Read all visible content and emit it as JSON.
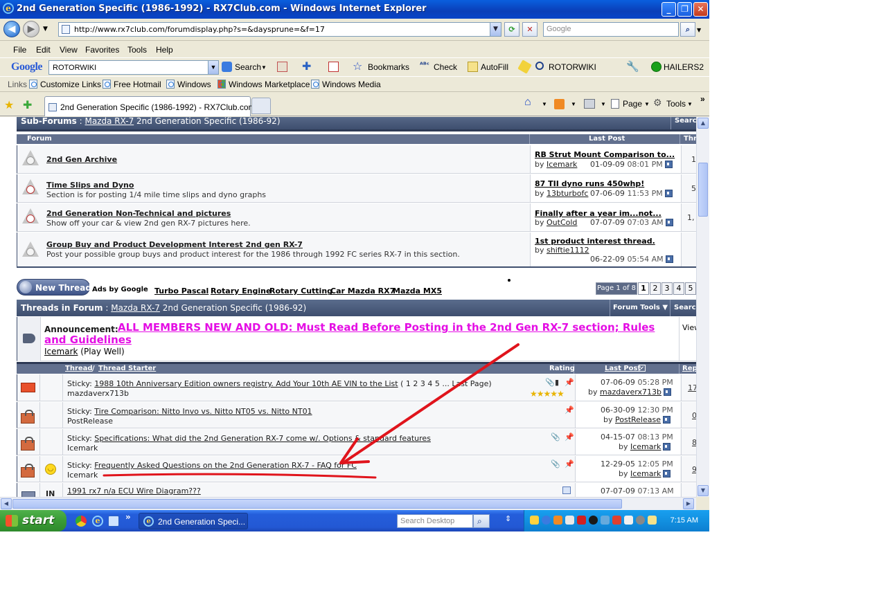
{
  "window": {
    "title": "2nd Generation Specific (1986-1992) - RX7Club.com - Windows Internet Explorer",
    "minimize": "_",
    "restore": "❐",
    "close": "✕"
  },
  "address": {
    "url": "http://www.rx7club.com/forumdisplay.php?s=&daysprune=&f=17",
    "search_placeholder": "Google"
  },
  "menu": [
    "File",
    "Edit",
    "View",
    "Favorites",
    "Tools",
    "Help"
  ],
  "google_toolbar": {
    "logo": "Google",
    "query": "ROTORWIKI",
    "search": "Search",
    "bookmarks": "Bookmarks",
    "check": "Check",
    "autofill": "AutoFill",
    "rotorwiki": "ROTORWIKI",
    "account": "HAILERS2"
  },
  "links_bar": {
    "label": "Links",
    "items": [
      "Customize Links",
      "Free Hotmail",
      "Windows",
      "Windows Marketplace",
      "Windows Media"
    ]
  },
  "tabs": {
    "active": "2nd Generation Specific (1986-1992) - RX7Club.com",
    "page": "Page",
    "tools": "Tools",
    "more": "»"
  },
  "subforums": {
    "label": "Sub-Forums",
    "crumb_link": "Mazda RX-7",
    "crumb_rest": "2nd Generation Specific (1986-92)",
    "search": "Search",
    "col_forum": "Forum",
    "col_last": "Last Post",
    "col_threads": "Thr",
    "rows": [
      {
        "title": "2nd Gen Archive",
        "desc": "",
        "last_title": "RB Strut Mount Comparison to...",
        "last_by": "Icemark",
        "last_date": "01-09-09",
        "last_time": "08:01 PM",
        "threads": "1"
      },
      {
        "title": "Time Slips and Dyno",
        "desc": "Section is for posting 1/4 mile time slips and dyno graphs",
        "last_title": "87 TII dyno runs 450whp!",
        "last_by": "13bturbofc",
        "last_date": "07-06-09",
        "last_time": "11:53 PM",
        "threads": "5"
      },
      {
        "title": "2nd Generation Non-Technical and pictures",
        "desc": "Show off your car & view 2nd gen RX-7 pictures here.",
        "last_title": "Finally after a year im...not...",
        "last_by": "OutCold",
        "last_date": "07-07-09",
        "last_time": "07:03 AM",
        "threads": "1,"
      },
      {
        "title": "Group Buy and Product Development Interest 2nd gen RX-7",
        "desc": "Post your possible group buys and product interest for the 1986 through 1992 FC series RX-7 in this section.",
        "last_title": "1st product interest thread.",
        "last_by": "shiftie1112",
        "last_date": "06-22-09",
        "last_time": "05:54 AM",
        "threads": ""
      }
    ]
  },
  "controls": {
    "new_thread": "New Thread",
    "ads_by": "Ads by Google",
    "ads": [
      "Turbo Pascal",
      "Rotary Engine",
      "Rotary Cutting",
      "Car Mazda RX7",
      "Mazda MX5"
    ],
    "page_of": "Page 1 of 8",
    "pages": [
      "1",
      "2",
      "3",
      "4",
      "5"
    ]
  },
  "threads": {
    "label": "Threads in Forum",
    "crumb_link": "Mazda RX-7",
    "crumb_rest": "2nd Generation Specific (1986-92)",
    "forum_tools": "Forum Tools ▼",
    "search": "Search",
    "announcement_label": "Announcement:",
    "announcement_title_line1": "ALL MEMBERS NEW AND OLD: Must Read Before Posting in the 2nd Gen RX-7 section; Rules",
    "announcement_title_line2": "and Guidelines",
    "announcement_user": "Icemark",
    "announcement_user_title": "(Play Well)",
    "announcement_view": "View",
    "col_thread": "Thread",
    "col_sep": "/",
    "col_starter": "Thread Starter",
    "col_rating": "Rating",
    "col_last": "Last Post",
    "col_replies": "Rep",
    "rows": [
      {
        "prefix": "Sticky:",
        "title": "1988 10th Anniversary Edition owners registry. Add Your 10th AE VIN to the List",
        "pages": "( 1 2 3 4 5 ... Last Page)",
        "starter": "mazdaverx713b",
        "date": "07-06-09",
        "time": "05:28 PM",
        "by": "mazdaverx713b",
        "replies": "17",
        "rating": 5
      },
      {
        "prefix": "Sticky:",
        "title": "Tire Comparison: Nitto Invo vs. Nitto NT05 vs. Nitto NT01",
        "pages": "",
        "starter": "PostRelease",
        "date": "06-30-09",
        "time": "12:30 PM",
        "by": "PostRelease",
        "replies": "0",
        "rating": 0
      },
      {
        "prefix": "Sticky:",
        "title": "Specifications: What did the 2nd Generation RX-7 come w/. Options & standard features",
        "pages": "",
        "starter": "Icemark",
        "date": "04-15-07",
        "time": "08:13 PM",
        "by": "Icemark",
        "replies": "8",
        "rating": 0
      },
      {
        "prefix": "Sticky:",
        "title": "Frequently Asked Questions on the 2nd Generation RX-7 - FAQ for FC",
        "pages": "",
        "starter": "Icemark",
        "date": "12-29-05",
        "time": "12:05 PM",
        "by": "Icemark",
        "replies": "9",
        "rating": 0
      },
      {
        "prefix": "",
        "title": "1991 rx7 n/a ECU Wire Diagram???",
        "pages": "",
        "starter": "",
        "date": "07-07-09",
        "time": "07:13 AM",
        "by": "",
        "replies": "",
        "rating": 0,
        "icon_text": "IN"
      }
    ]
  },
  "taskbar": {
    "start": "start",
    "task": "2nd Generation Speci...",
    "desktop_search": "Search Desktop",
    "time": "7:15 AM"
  },
  "colors": {
    "announcement": "#e40ee4",
    "annotation_arrow": "#e0141c",
    "category_bar": "#3e4e6e"
  }
}
